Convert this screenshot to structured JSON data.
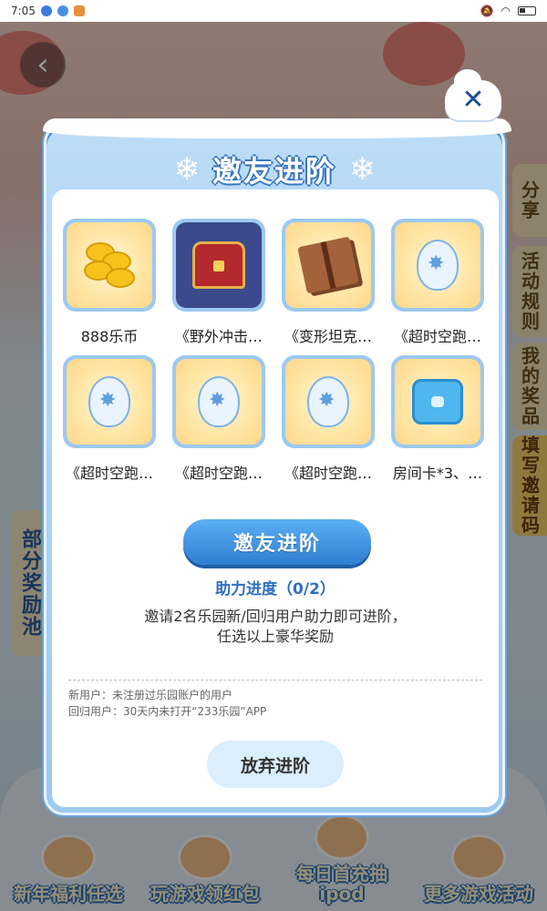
{
  "statusbar": {
    "time": "7:05"
  },
  "background": {
    "side_tabs": [
      "分享",
      "活动规则",
      "我的奖品",
      "填写邀请码"
    ],
    "left_pool_label": "部分奖励池",
    "bottom_nav": [
      "新年福利任选",
      "玩游戏领红包",
      "每日首充抽ipod",
      "更多游戏活动"
    ]
  },
  "modal": {
    "title": "邀友进阶",
    "close_label": "✕",
    "rewards": [
      {
        "label": "888乐币",
        "icon": "coin-stack-icon"
      },
      {
        "label": "《野外冲击…",
        "icon": "treasure-chest-icon"
      },
      {
        "label": "《变形坦克…",
        "icon": "gift-box-icon"
      },
      {
        "label": "《超时空跑…",
        "icon": "egg-book-icon"
      },
      {
        "label": "《超时空跑…",
        "icon": "egg-candy-icon"
      },
      {
        "label": "《超时空跑…",
        "icon": "egg-orb-icon"
      },
      {
        "label": "《超时空跑…",
        "icon": "egg-potion-icon"
      },
      {
        "label": "房间卡*3、…",
        "icon": "blue-cube-icon"
      }
    ],
    "invite_button": "邀友进阶",
    "progress": "助力进度（0/2）",
    "description_line1": "邀请2名乐园新/回归用户助力即可进阶，",
    "description_line2": "任选以上豪华奖励",
    "note_new": "新用户：未注册过乐园账户的用户",
    "note_return": "回归用户：30天内未打开“233乐园”APP",
    "give_up_button": "放弃进阶"
  }
}
